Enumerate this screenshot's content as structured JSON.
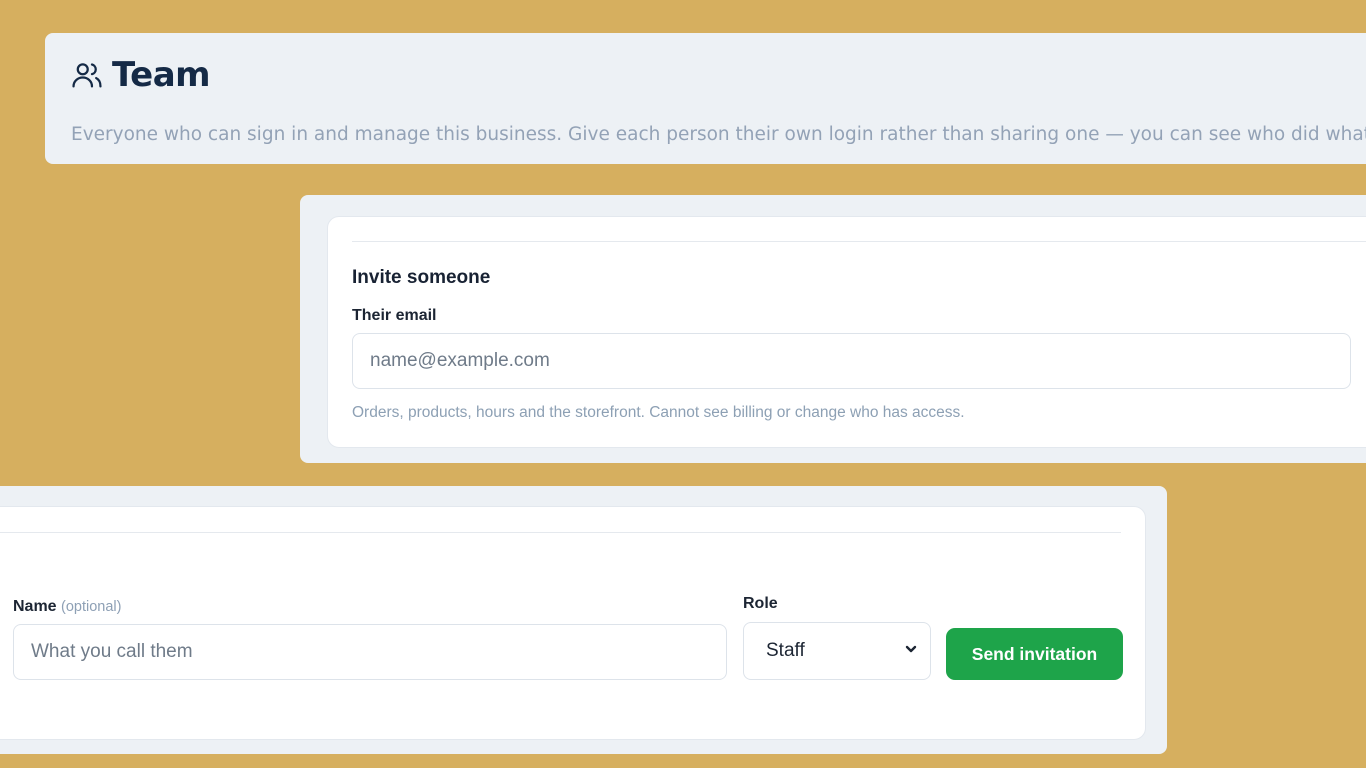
{
  "header": {
    "title": "Team",
    "icon": "users-icon",
    "description": "Everyone who can sign in and manage this business. Give each person their own login rather than sharing one — you can see who did what, a"
  },
  "invite": {
    "heading": "Invite someone",
    "email_label": "Their email",
    "email_placeholder": "name@example.com",
    "email_value": "",
    "role_hint": "Orders, products, hours and the storefront. Cannot see billing or change who has access."
  },
  "form": {
    "name_label": "Name",
    "name_optional": "(optional)",
    "name_placeholder": "What you call them",
    "name_value": "",
    "role_label": "Role",
    "role_selected": "Staff",
    "role_chevron_icon": "chevron-down-icon",
    "send_label": "Send invitation"
  },
  "colors": {
    "background": "#d6af5f",
    "panel": "#edf1f5",
    "title": "#152a46",
    "muted_text": "#93a2b6",
    "primary_button": "#1ea44a"
  }
}
